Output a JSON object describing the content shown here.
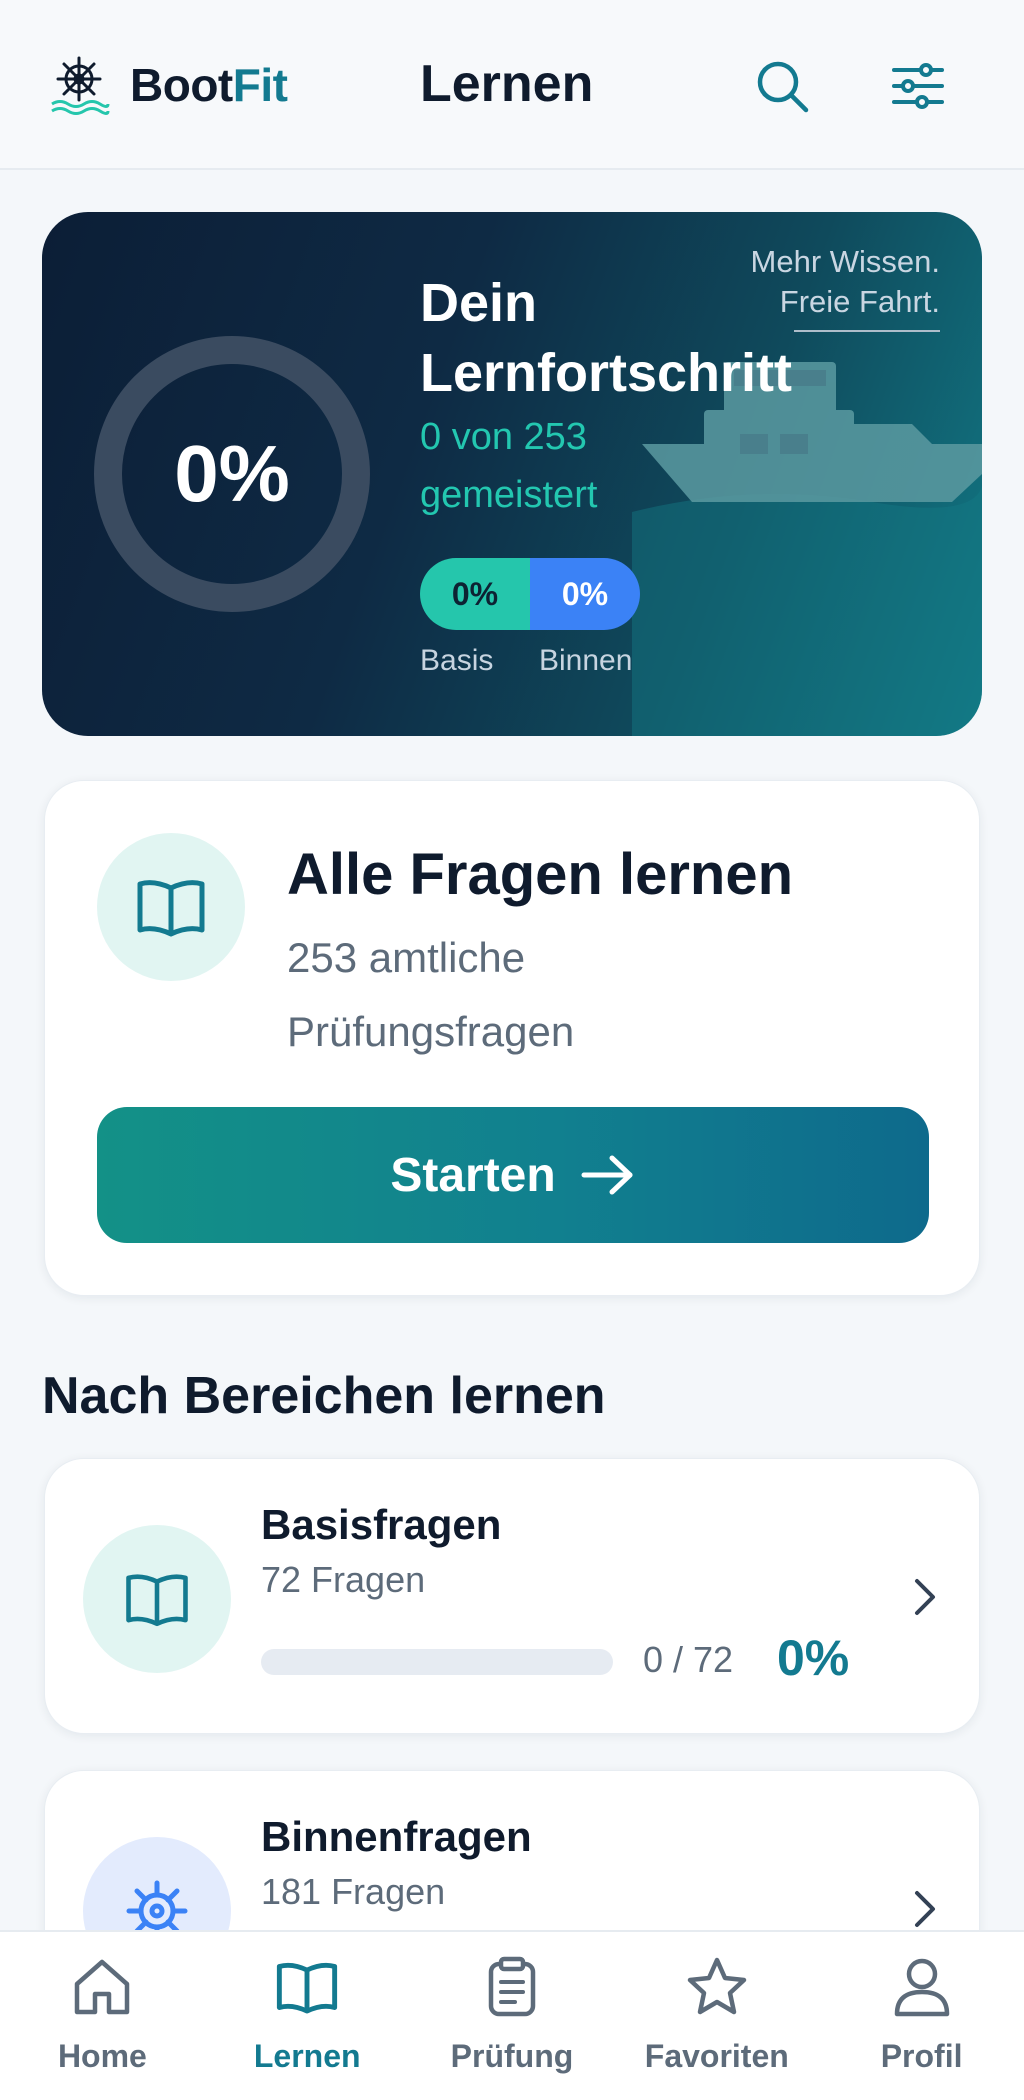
{
  "header": {
    "brand_part1": "Boot",
    "brand_part2": "Fit",
    "title": "Lernen",
    "icons": [
      "ship-wheel-logo-icon",
      "search-icon",
      "sliders-icon"
    ]
  },
  "hero": {
    "progress_percent_label": "0%",
    "progress_fraction": 0,
    "title": "Dein Lernfortschritt",
    "subtitle": "0 von 253 gemeistert",
    "slogan_line1": "Mehr Wissen.",
    "slogan_line2": "Freie Fahrt.",
    "split": [
      {
        "value": "0%",
        "label": "Basis"
      },
      {
        "value": "0%",
        "label": "Binnen"
      }
    ]
  },
  "all_questions": {
    "title": "Alle Fragen lernen",
    "subtitle": "253 amtliche Prüfungsfragen",
    "button_label": "Starten",
    "icon": "book-icon"
  },
  "section": {
    "title": "Nach Bereichen lernen"
  },
  "categories": [
    {
      "title": "Basisfragen",
      "count": "72 Fragen",
      "ratio": "0 / 72",
      "percent": "0%",
      "progress": 0,
      "icon": "book-icon"
    },
    {
      "title": "Binnenfragen",
      "count": "181 Fragen",
      "icon": "ship-wheel-icon"
    }
  ],
  "nav": {
    "items": [
      {
        "label": "Home",
        "icon": "home-icon"
      },
      {
        "label": "Lernen",
        "icon": "book-icon",
        "active": true
      },
      {
        "label": "Prüfung",
        "icon": "clipboard-icon"
      },
      {
        "label": "Favoriten",
        "icon": "star-icon"
      },
      {
        "label": "Profil",
        "icon": "user-icon"
      }
    ]
  },
  "colors": {
    "accent": "#137a90",
    "teal": "#25c6ac",
    "blue": "#3b82f6",
    "text": "#0f1b2d",
    "muted": "#5d6b7a"
  }
}
